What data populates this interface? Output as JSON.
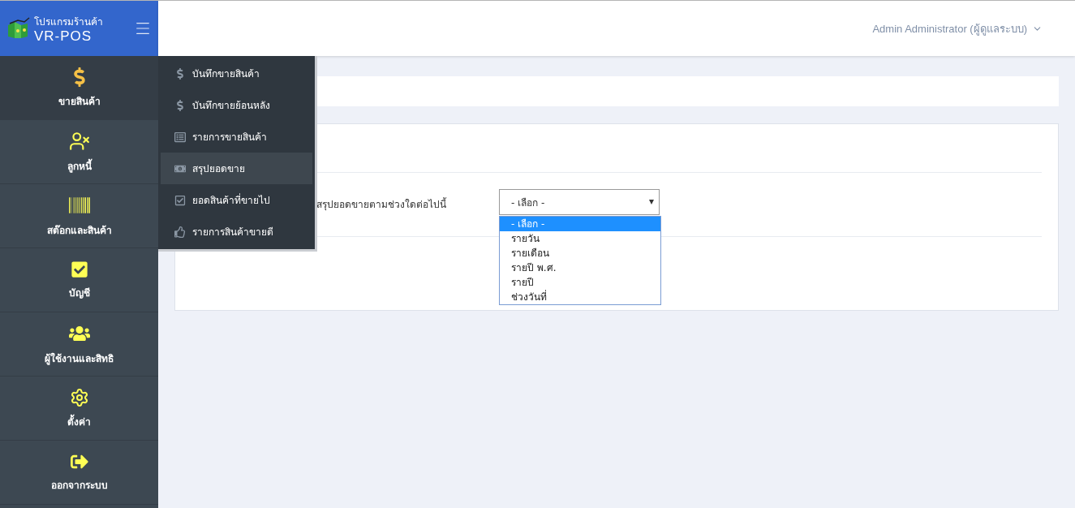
{
  "brand": {
    "title": "โปรแกรมร้านค้า",
    "name": "VR-POS"
  },
  "user_menu": {
    "label": "Admin Administrator (ผู้ดูแลระบบ)"
  },
  "sidebar": {
    "items": [
      {
        "kind": "dollar",
        "label": "ขายสินค้า",
        "selected": true
      },
      {
        "kind": "debtor",
        "label": "ลูกหนี้",
        "selected": false
      },
      {
        "kind": "barcode",
        "label": "สต๊อกและสินค้า",
        "selected": false
      },
      {
        "kind": "check",
        "label": "บัญชี",
        "selected": false
      },
      {
        "kind": "users",
        "label": "ผู้ใช้งานและสิทธิ",
        "selected": false
      },
      {
        "kind": "gear",
        "label": "ตั้งค่า",
        "selected": false
      },
      {
        "kind": "logout",
        "label": "ออกจากระบบ",
        "selected": false
      }
    ]
  },
  "submenu": {
    "items": [
      {
        "kind": "dollar",
        "label": "บันทึกขายสินค้า",
        "selected": false
      },
      {
        "kind": "dollar",
        "label": "บันทึกขายย้อนหลัง",
        "selected": false
      },
      {
        "kind": "list",
        "label": "รายการขายสินค้า",
        "selected": false
      },
      {
        "kind": "money",
        "label": "สรุปยอดขาย",
        "selected": true
      },
      {
        "kind": "check",
        "label": "ยอดสินค้าที่ขายไป",
        "selected": false
      },
      {
        "kind": "thumb",
        "label": "รายการสินค้าขายดี",
        "selected": false
      }
    ]
  },
  "form": {
    "label": "สรุปยอดขายตามช่วงใดต่อไปนี้",
    "select": {
      "value": "- เลือก -",
      "expanded": true,
      "options": [
        {
          "label": "- เลือก -",
          "selected": true
        },
        {
          "label": "รายวัน",
          "selected": false
        },
        {
          "label": "รายเดือน",
          "selected": false
        },
        {
          "label": "รายปี พ.ศ.",
          "selected": false
        },
        {
          "label": "รายปี",
          "selected": false
        },
        {
          "label": "ช่วงวันที่",
          "selected": false
        }
      ]
    }
  }
}
